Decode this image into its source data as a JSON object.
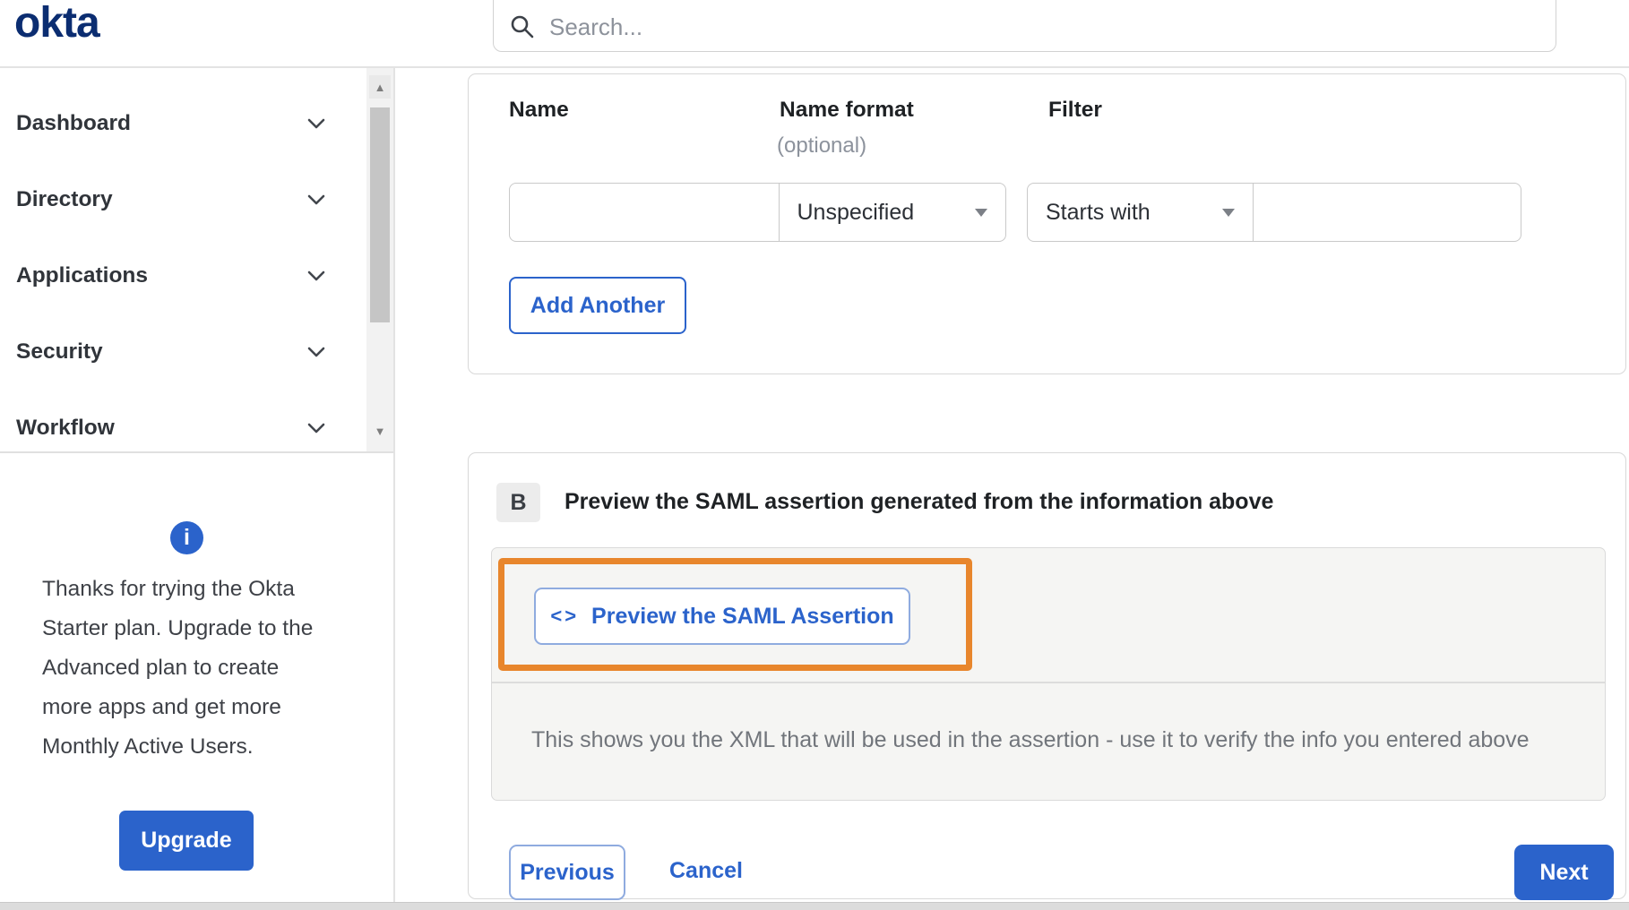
{
  "brand": {
    "logo": "okta"
  },
  "header": {
    "search_placeholder": "Search..."
  },
  "sidebar": {
    "items": [
      {
        "label": "Dashboard"
      },
      {
        "label": "Directory"
      },
      {
        "label": "Applications"
      },
      {
        "label": "Security"
      },
      {
        "label": "Workflow"
      }
    ],
    "upgrade": {
      "message": "Thanks for trying the Okta Starter plan. Upgrade to the Advanced plan to create more apps and get more Monthly Active Users.",
      "button_label": "Upgrade"
    }
  },
  "main": {
    "attribute_form": {
      "name_label": "Name",
      "name_format_label": "Name format",
      "name_format_sublabel": "(optional)",
      "filter_label": "Filter",
      "name_value": "",
      "name_format_value": "Unspecified",
      "filter_type_value": "Starts with",
      "filter_value": "",
      "add_another_label": "Add Another"
    },
    "section_b": {
      "badge": "B",
      "title": "Preview the SAML assertion generated from the information above",
      "preview_button_icon": "<>",
      "preview_button_label": "Preview the SAML Assertion",
      "note": "This shows you the XML that will be used in the assertion - use it to verify the info you entered above"
    },
    "footer": {
      "previous_label": "Previous",
      "cancel_label": "Cancel",
      "next_label": "Next"
    }
  },
  "scrollbar": {
    "up_glyph": "▲",
    "down_glyph": "▼"
  },
  "icons": {
    "info_glyph": "i"
  },
  "colors": {
    "accent_blue": "#2b63cb",
    "logo_navy": "#0b2d71",
    "highlight_orange": "#e8862c"
  }
}
